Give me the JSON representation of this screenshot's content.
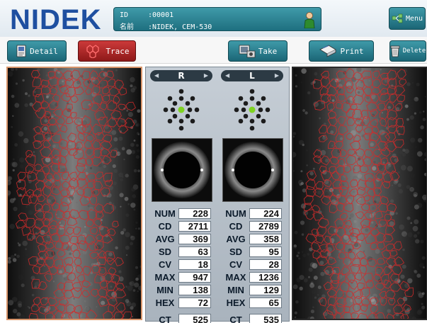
{
  "app": {
    "logo": "NIDEK"
  },
  "patient": {
    "id_label": "ID",
    "id_value": ":00001",
    "name_label": "名前",
    "name_value": ":NIDEK, CEM-530"
  },
  "toolbar": {
    "menu_label": "Menu",
    "detail_label": "Detail",
    "trace_label": "Trace",
    "take_label": "Take",
    "print_label": "Print",
    "delete_label": "Delete"
  },
  "eyes": {
    "right": {
      "label": "R",
      "stats": [
        {
          "label": "NUM",
          "value": "228"
        },
        {
          "label": "CD",
          "value": "2711"
        },
        {
          "label": "AVG",
          "value": "369"
        },
        {
          "label": "SD",
          "value": "63"
        },
        {
          "label": "CV",
          "value": "18"
        },
        {
          "label": "MAX",
          "value": "947"
        },
        {
          "label": "MIN",
          "value": "138"
        },
        {
          "label": "HEX",
          "value": "72"
        }
      ],
      "ct": {
        "label": "CT",
        "value": "525"
      }
    },
    "left": {
      "label": "L",
      "stats": [
        {
          "label": "NUM",
          "value": "224"
        },
        {
          "label": "CD",
          "value": "2789"
        },
        {
          "label": "AVG",
          "value": "358"
        },
        {
          "label": "SD",
          "value": "95"
        },
        {
          "label": "CV",
          "value": "28"
        },
        {
          "label": "MAX",
          "value": "1236"
        },
        {
          "label": "MIN",
          "value": "129"
        },
        {
          "label": "HEX",
          "value": "65"
        }
      ],
      "ct": {
        "label": "CT",
        "value": "535"
      }
    }
  },
  "colors": {
    "accent": "#2a8796",
    "cell_outline": "#d22a2a",
    "fixation_center": "#7ed321"
  },
  "icons": [
    "person-icon",
    "menu-icon",
    "detail-icon",
    "trace-icon",
    "take-icon",
    "print-icon",
    "delete-icon"
  ]
}
